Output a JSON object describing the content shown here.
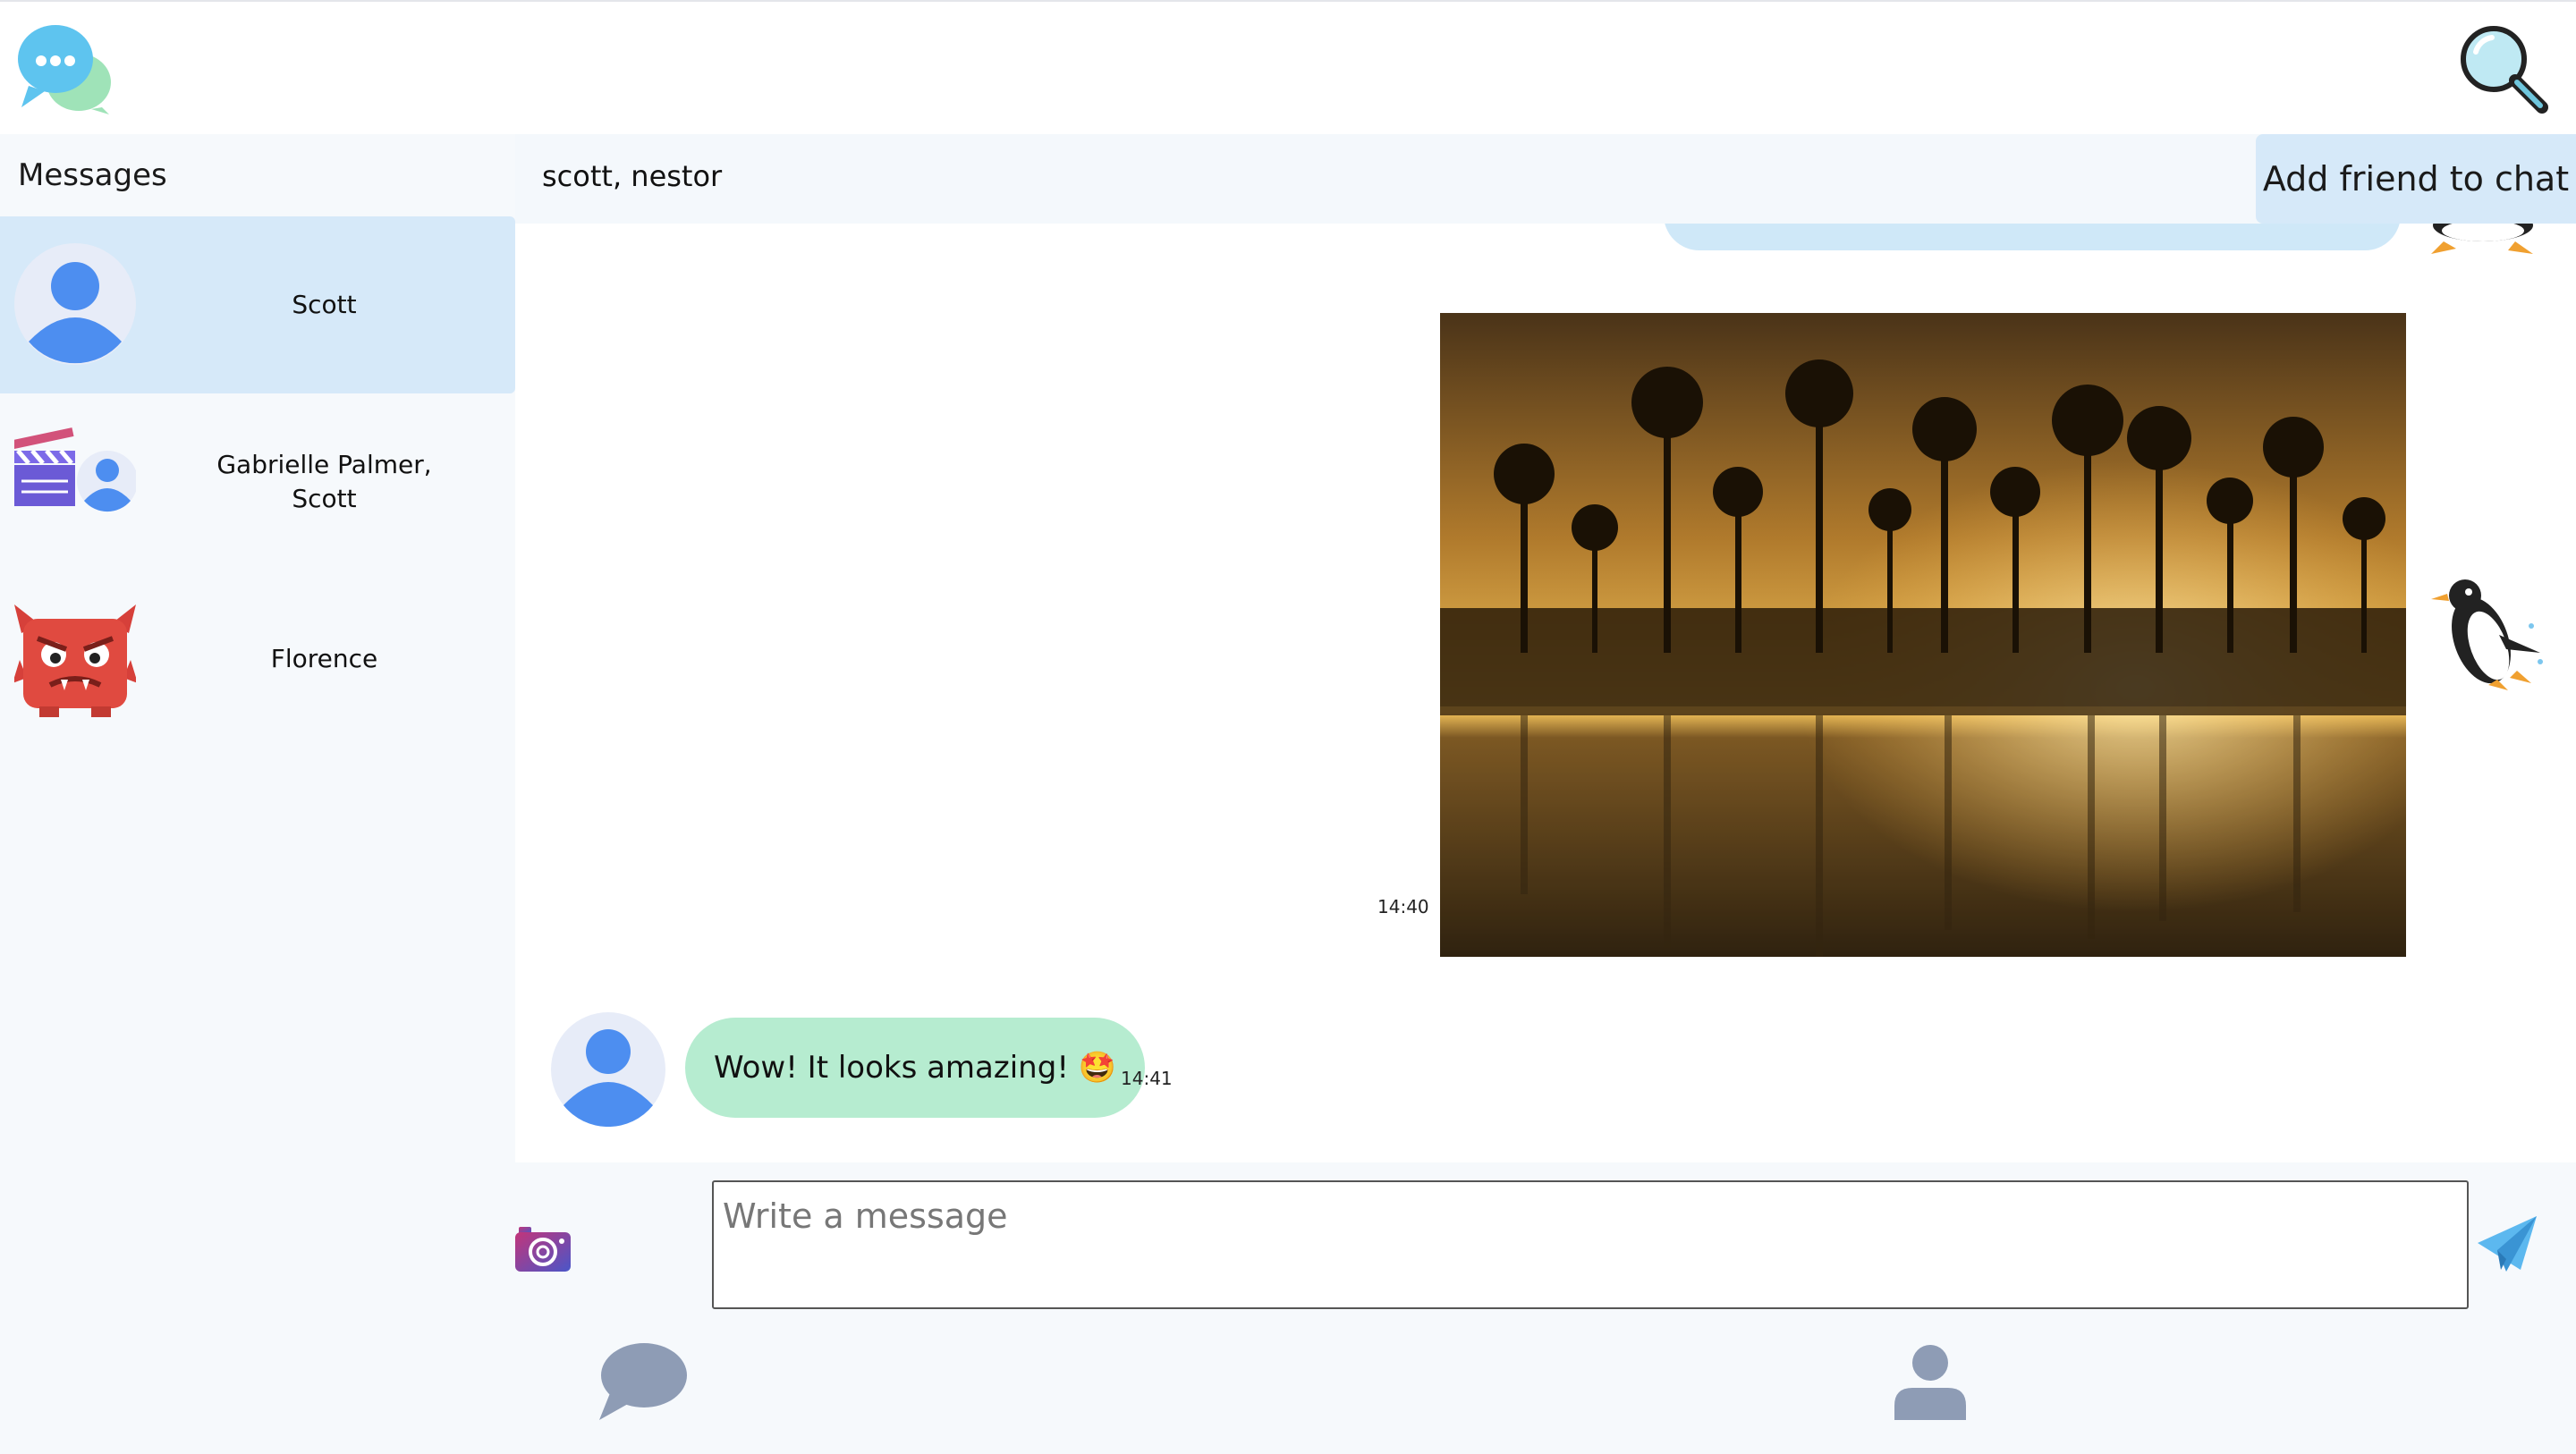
{
  "sidebar": {
    "title": "Messages",
    "conversations": [
      {
        "name": "Scott",
        "avatar": "person-avatar-icon",
        "active": true
      },
      {
        "name": "Gabrielle Palmer, Scott",
        "avatar": "group-avatar-clapperboard-person",
        "active": false
      },
      {
        "name": "Florence",
        "avatar": "red-monster-avatar",
        "active": false
      }
    ]
  },
  "chat": {
    "title": "scott, nestor",
    "add_friend_label": "Add friend to chat"
  },
  "messages": [
    {
      "type": "image",
      "description_icon": "sunset-palm-photo",
      "time": "14:40",
      "sticker": "penguin-sticker"
    },
    {
      "type": "text",
      "text": "Wow! It looks amazing! 🤩",
      "time": "14:41",
      "avatar": "person-avatar-icon"
    }
  ],
  "composer": {
    "placeholder": "Write a message"
  },
  "icons": {
    "logo": "chat-bubbles-logo",
    "search": "magnifier-icon",
    "camera": "camera-icon",
    "send": "paper-plane-icon",
    "nav_chat": "speech-bubble-icon",
    "nav_profile": "person-icon"
  },
  "colors": {
    "active_conversation": "#d6e9f9",
    "incoming_bubble": "#b6ecd0",
    "outgoing_bubble": "#cfe8f8",
    "avatar_blue": "#4d8ef0",
    "nav_icon": "#8e9cb5"
  }
}
